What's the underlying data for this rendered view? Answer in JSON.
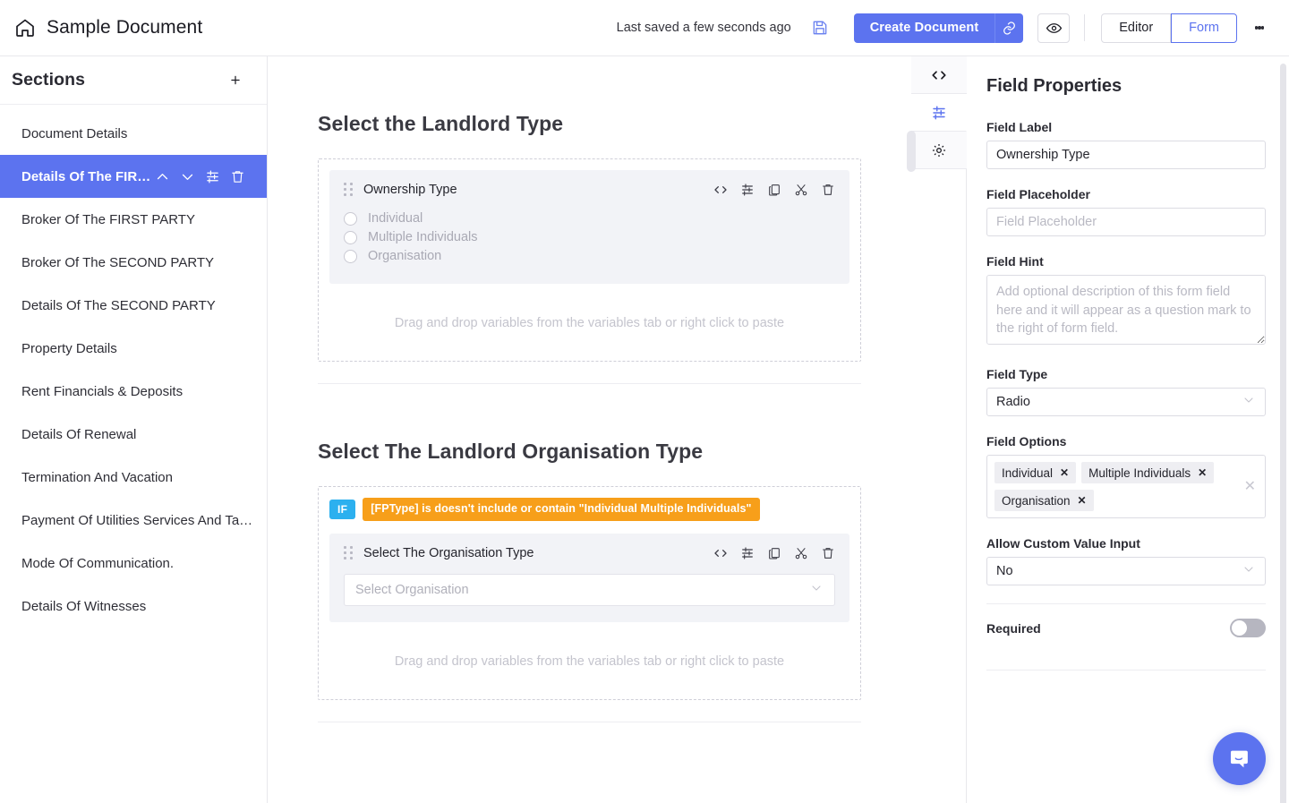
{
  "topbar": {
    "home_icon": "home-icon",
    "document_title": "Sample Document",
    "saved_status": "Last saved a few seconds ago",
    "save_icon": "floppy-disk-icon",
    "create_button": "Create Document",
    "link_icon": "link-icon",
    "preview_icon": "eye-icon",
    "view_modes": [
      {
        "label": "Editor",
        "active": false
      },
      {
        "label": "Form",
        "active": true
      }
    ],
    "more_icon": "kebab-menu-icon",
    "accent_color": "#5c73ef"
  },
  "sidebar": {
    "heading": "Sections",
    "add_icon": "plus-icon",
    "items": [
      {
        "label": "Document Details",
        "active": false
      },
      {
        "label": "Details Of The FIRST P…",
        "active": true
      },
      {
        "label": "Broker Of The FIRST PARTY",
        "active": false
      },
      {
        "label": "Broker Of The SECOND PARTY",
        "active": false
      },
      {
        "label": "Details Of The SECOND PARTY",
        "active": false
      },
      {
        "label": "Property Details",
        "active": false
      },
      {
        "label": "Rent Financials & Deposits",
        "active": false
      },
      {
        "label": "Details Of Renewal",
        "active": false
      },
      {
        "label": "Termination And Vacation",
        "active": false
      },
      {
        "label": "Payment Of Utilities Services And Ta…",
        "active": false
      },
      {
        "label": "Mode Of Communication.",
        "active": false
      },
      {
        "label": "Details Of Witnesses",
        "active": false
      }
    ],
    "active_row_icons": [
      "chevron-up-icon",
      "chevron-down-icon",
      "sliders-icon",
      "trash-icon"
    ]
  },
  "canvas": {
    "drag_hint": "Drag and drop variables from the variables tab or right click to paste",
    "field_tool_icons": [
      "code-icon",
      "sliders-icon",
      "copy-icon",
      "scissors-icon",
      "trash-icon"
    ],
    "blocks": [
      {
        "title": "Select the Landlord Type",
        "field_label": "Ownership Type",
        "field_kind": "radio",
        "options": [
          "Individual",
          "Multiple Individuals",
          "Organisation"
        ]
      },
      {
        "title": "Select The Landlord Organisation Type",
        "condition": {
          "keyword": "IF",
          "expression": "[FPType] is doesn't include or contain \"Individual Multiple Individuals\"",
          "keyword_color": "#2cb0ef",
          "expression_color": "#f79f1a"
        },
        "field_label": "Select The Organisation Type",
        "field_kind": "select",
        "select_placeholder": "Select Organisation"
      }
    ]
  },
  "rail": {
    "tabs": [
      {
        "icon": "code-icon",
        "active": false
      },
      {
        "icon": "sliders-icon",
        "active": true
      },
      {
        "icon": "gear-icon",
        "active": false
      }
    ],
    "collapse_handle": "panel-resize-handle"
  },
  "properties": {
    "heading": "Field Properties",
    "field_label_caption": "Field Label",
    "field_label_value": "Ownership Type",
    "field_placeholder_caption": "Field Placeholder",
    "field_placeholder_value": "",
    "field_placeholder_placeholder": "Field Placeholder",
    "field_hint_caption": "Field Hint",
    "field_hint_value": "",
    "field_hint_placeholder": "Add optional description of this form field here and it will appear as a question mark to the right of form field.",
    "field_type_caption": "Field Type",
    "field_type_value": "Radio",
    "field_options_caption": "Field Options",
    "field_options": [
      "Individual",
      "Multiple Individuals",
      "Organisation"
    ],
    "tag_remove_glyph": "✕",
    "clear_all_glyph": "✕",
    "allow_custom_caption": "Allow Custom Value Input",
    "allow_custom_value": "No",
    "required_caption": "Required",
    "required_on": false
  },
  "chat": {
    "icon": "chat-bubble-icon",
    "color": "#5c73ef"
  }
}
